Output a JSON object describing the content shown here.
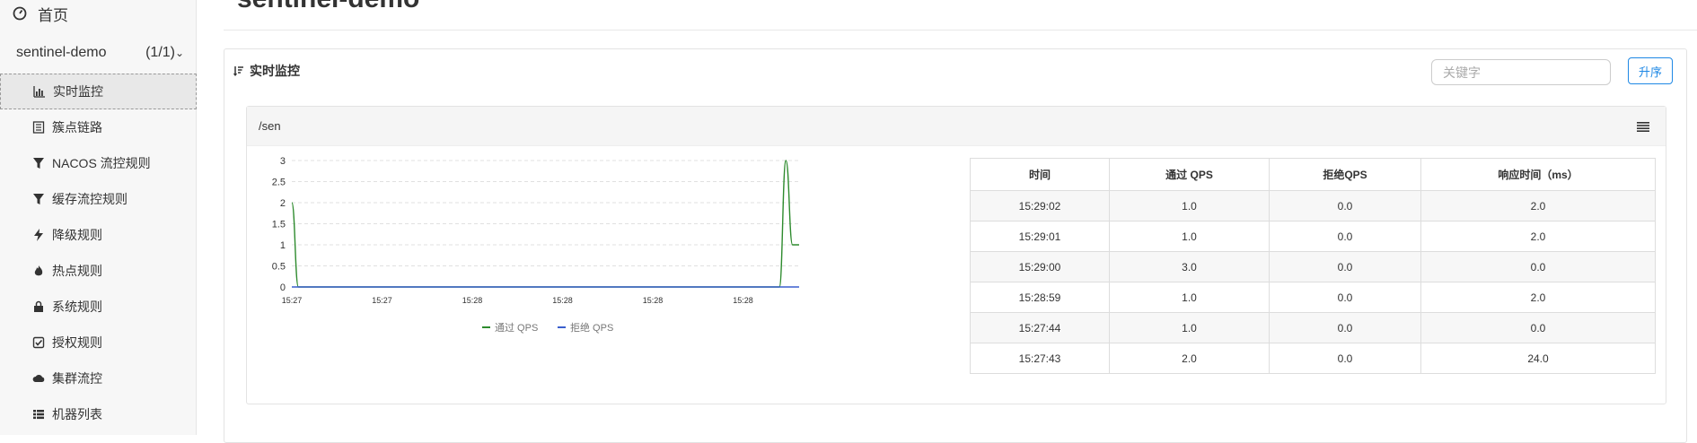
{
  "sidebar": {
    "home_label": "首页",
    "app": {
      "name": "sentinel-demo",
      "count": "(1/1)"
    },
    "items": [
      {
        "label": "实时监控",
        "icon": "bar-chart-icon",
        "active": true
      },
      {
        "label": "簇点链路",
        "icon": "list-icon"
      },
      {
        "label": "NACOS 流控规则",
        "icon": "filter-icon"
      },
      {
        "label": "缓存流控规则",
        "icon": "filter-icon"
      },
      {
        "label": "降级规则",
        "icon": "flash-icon"
      },
      {
        "label": "热点规则",
        "icon": "fire-icon"
      },
      {
        "label": "系统规则",
        "icon": "lock-icon"
      },
      {
        "label": "授权规则",
        "icon": "check-square-icon"
      },
      {
        "label": "集群流控",
        "icon": "cloud-icon"
      },
      {
        "label": "机器列表",
        "icon": "th-list-icon"
      }
    ]
  },
  "page": {
    "title": "sentinel-demo"
  },
  "panel": {
    "title": "实时监控",
    "search_placeholder": "关键字",
    "sort_label": "升序"
  },
  "resource": {
    "name": "/sen"
  },
  "table": {
    "headers": [
      "时间",
      "通过 QPS",
      "拒绝QPS",
      "响应时间（ms）"
    ],
    "rows": [
      [
        "15:29:02",
        "1.0",
        "0.0",
        "2.0"
      ],
      [
        "15:29:01",
        "1.0",
        "0.0",
        "2.0"
      ],
      [
        "15:29:00",
        "3.0",
        "0.0",
        "0.0"
      ],
      [
        "15:28:59",
        "1.0",
        "0.0",
        "2.0"
      ],
      [
        "15:27:44",
        "1.0",
        "0.0",
        "0.0"
      ],
      [
        "15:27:43",
        "2.0",
        "0.0",
        "24.0"
      ]
    ]
  },
  "chart_data": {
    "type": "line",
    "x_tick_labels": [
      "15:27",
      "15:27",
      "15:28",
      "15:28",
      "15:28",
      "15:28"
    ],
    "y_ticks": [
      "0",
      "0.5",
      "1",
      "1.5",
      "2",
      "2.5",
      "3"
    ],
    "ylim": [
      0,
      3
    ],
    "series": [
      {
        "name": "通过 QPS",
        "color": "#2e8b2e",
        "values": [
          2,
          0,
          0,
          0,
          0,
          0,
          0,
          0,
          0,
          0,
          0,
          0,
          0,
          0,
          0,
          0,
          0,
          0,
          0,
          0,
          0,
          0,
          0,
          0,
          0,
          0,
          0,
          0,
          0,
          0,
          0,
          0,
          0,
          0,
          0,
          0,
          0,
          0,
          0,
          0,
          0,
          0,
          0,
          0,
          0,
          0,
          0,
          0,
          0,
          0,
          0,
          0,
          0,
          0,
          0,
          0,
          0,
          0,
          0,
          0,
          0,
          0,
          0,
          0,
          0,
          0,
          0,
          0,
          0,
          0,
          0,
          0,
          0,
          0,
          0,
          3,
          1,
          1
        ]
      },
      {
        "name": "拒绝 QPS",
        "color": "#3a5fcd",
        "values": [
          0,
          0,
          0,
          0,
          0,
          0,
          0,
          0,
          0,
          0,
          0,
          0,
          0,
          0,
          0,
          0,
          0,
          0,
          0,
          0,
          0,
          0,
          0,
          0,
          0,
          0,
          0,
          0,
          0,
          0,
          0,
          0,
          0,
          0,
          0,
          0,
          0,
          0,
          0,
          0,
          0,
          0,
          0,
          0,
          0,
          0,
          0,
          0,
          0,
          0,
          0,
          0,
          0,
          0,
          0,
          0,
          0,
          0,
          0,
          0,
          0,
          0,
          0,
          0,
          0,
          0,
          0,
          0,
          0,
          0,
          0,
          0,
          0,
          0,
          0,
          0,
          0,
          0
        ]
      }
    ],
    "legend_position": "bottom-center",
    "grid": true
  }
}
